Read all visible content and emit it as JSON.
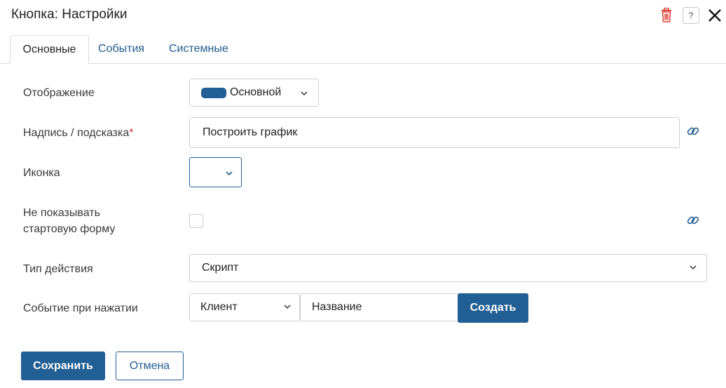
{
  "dialog": {
    "title": "Кнопка: Настройки",
    "help_label": "?"
  },
  "tabs": [
    {
      "label": "Основные",
      "active": true
    },
    {
      "label": "События",
      "active": false
    },
    {
      "label": "Системные",
      "active": false
    }
  ],
  "form": {
    "display": {
      "label": "Отображение",
      "value": "Основной",
      "swatch_color": "#215f94"
    },
    "caption": {
      "label": "Надпись / подсказка",
      "required_mark": "*",
      "value": "Построить график"
    },
    "icon": {
      "label": "Иконка",
      "value": ""
    },
    "hide_start_form": {
      "label_line1": "Не показывать",
      "label_line2": "стартовую форму",
      "checked": false
    },
    "action_type": {
      "label": "Тип действия",
      "value": "Скрипт"
    },
    "click_event": {
      "label": "Событие при нажатии",
      "side_value": "Клиент",
      "name_value": "Название",
      "create_label": "Создать"
    }
  },
  "footer": {
    "save_label": "Сохранить",
    "cancel_label": "Отмена"
  },
  "colors": {
    "accent": "#215f94",
    "required": "#d0342c",
    "delete": "#e0453a"
  },
  "icons": [
    "trash-icon",
    "help-icon",
    "close-icon",
    "link-icon",
    "chevron-down-icon"
  ]
}
